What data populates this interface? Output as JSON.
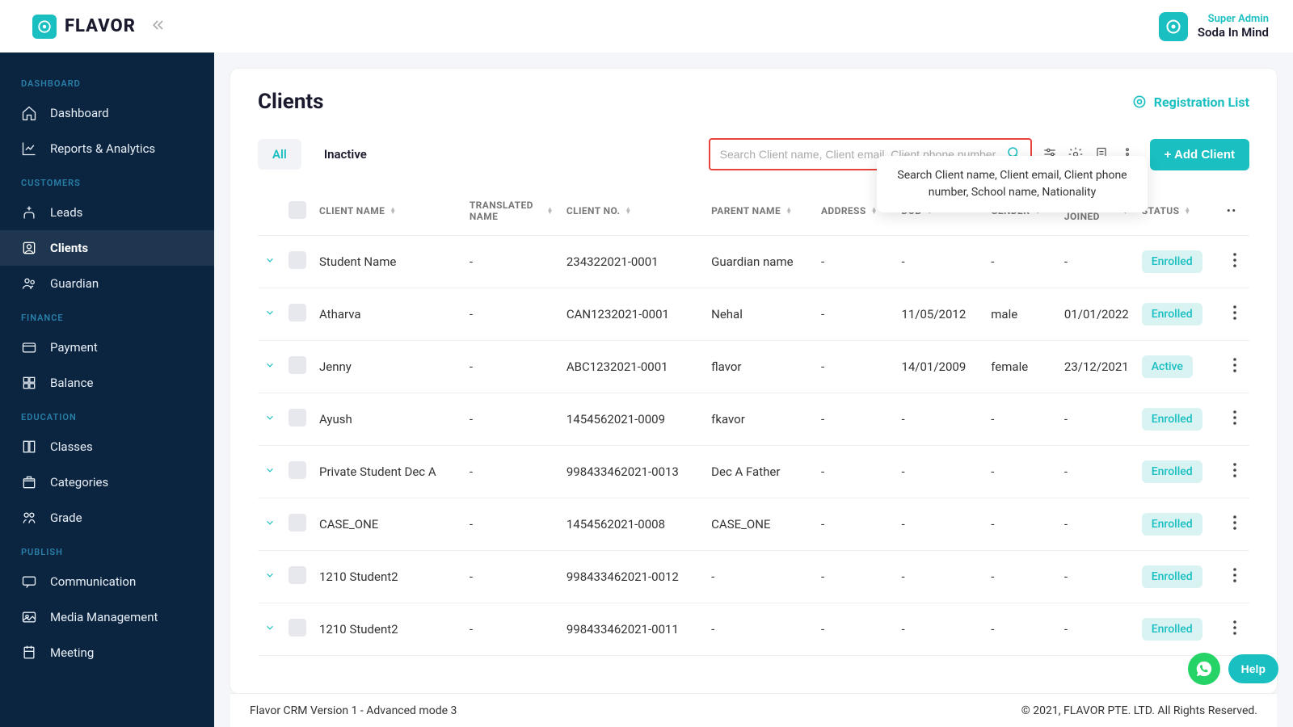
{
  "brand": {
    "name": "FLAVOR"
  },
  "user": {
    "role": "Super Admin",
    "name": "Soda In Mind"
  },
  "sidebar": {
    "sections": [
      {
        "label": "DASHBOARD",
        "items": [
          {
            "label": "Dashboard",
            "icon": "home"
          },
          {
            "label": "Reports & Analytics",
            "icon": "chart"
          }
        ]
      },
      {
        "label": "CUSTOMERS",
        "items": [
          {
            "label": "Leads",
            "icon": "leads"
          },
          {
            "label": "Clients",
            "icon": "user-box",
            "active": true
          },
          {
            "label": "Guardian",
            "icon": "guardian"
          }
        ]
      },
      {
        "label": "FINANCE",
        "items": [
          {
            "label": "Payment",
            "icon": "card"
          },
          {
            "label": "Balance",
            "icon": "grid"
          }
        ]
      },
      {
        "label": "EDUCATION",
        "items": [
          {
            "label": "Classes",
            "icon": "book"
          },
          {
            "label": "Categories",
            "icon": "box"
          },
          {
            "label": "Grade",
            "icon": "grade"
          }
        ]
      },
      {
        "label": "PUBLISH",
        "items": [
          {
            "label": "Communication",
            "icon": "chat"
          },
          {
            "label": "Media Management",
            "icon": "media"
          },
          {
            "label": "Meeting",
            "icon": "meeting"
          }
        ]
      }
    ]
  },
  "page": {
    "title": "Clients",
    "registration_link": "Registration List",
    "tabs": {
      "all": "All",
      "inactive": "Inactive"
    },
    "search_placeholder": "Search Client name, Client email, Client phone number",
    "tooltip": "Search Client name, Client email, Client phone number, School name, Nationality",
    "add_button": "+ Add Client"
  },
  "columns": {
    "client_name": "CLIENT NAME",
    "translated_name": "TRANSLATED NAME",
    "client_no": "CLIENT NO.",
    "parent_name": "PARENT NAME",
    "address": "ADDRESS",
    "dob": "DOB",
    "gender": "GENDER",
    "date_joined": "DATE JOINED",
    "status": "STATUS"
  },
  "rows": [
    {
      "name": "Student Name",
      "translated": "-",
      "no": "234322021-0001",
      "parent": "Guardian name",
      "address": "-",
      "dob": "-",
      "gender": "-",
      "joined": "-",
      "status": "Enrolled"
    },
    {
      "name": "Atharva",
      "translated": "-",
      "no": "CAN1232021-0001",
      "parent": "Nehal",
      "address": "-",
      "dob": "11/05/2012",
      "gender": "male",
      "joined": "01/01/2022",
      "status": "Enrolled"
    },
    {
      "name": "Jenny",
      "translated": "-",
      "no": "ABC1232021-0001",
      "parent": "flavor",
      "address": "-",
      "dob": "14/01/2009",
      "gender": "female",
      "joined": "23/12/2021",
      "status": "Active"
    },
    {
      "name": "Ayush",
      "translated": "-",
      "no": "1454562021-0009",
      "parent": "fkavor",
      "address": "-",
      "dob": "-",
      "gender": "-",
      "joined": "-",
      "status": "Enrolled"
    },
    {
      "name": "Private Student Dec A",
      "translated": "-",
      "no": "998433462021-0013",
      "parent": "Dec A Father",
      "address": "-",
      "dob": "-",
      "gender": "-",
      "joined": "-",
      "status": "Enrolled"
    },
    {
      "name": "CASE_ONE",
      "translated": "-",
      "no": "1454562021-0008",
      "parent": "CASE_ONE",
      "address": "-",
      "dob": "-",
      "gender": "-",
      "joined": "-",
      "status": "Enrolled"
    },
    {
      "name": "1210 Student2",
      "translated": "-",
      "no": "998433462021-0012",
      "parent": "-",
      "address": "-",
      "dob": "-",
      "gender": "-",
      "joined": "-",
      "status": "Enrolled"
    },
    {
      "name": "1210 Student2",
      "translated": "-",
      "no": "998433462021-0011",
      "parent": "-",
      "address": "-",
      "dob": "-",
      "gender": "-",
      "joined": "-",
      "status": "Enrolled"
    }
  ],
  "footer": {
    "version": "Flavor CRM Version 1 - Advanced mode 3",
    "copyright": "© 2021, FLAVOR PTE. LTD. All Rights Reserved."
  },
  "help_label": "Help"
}
